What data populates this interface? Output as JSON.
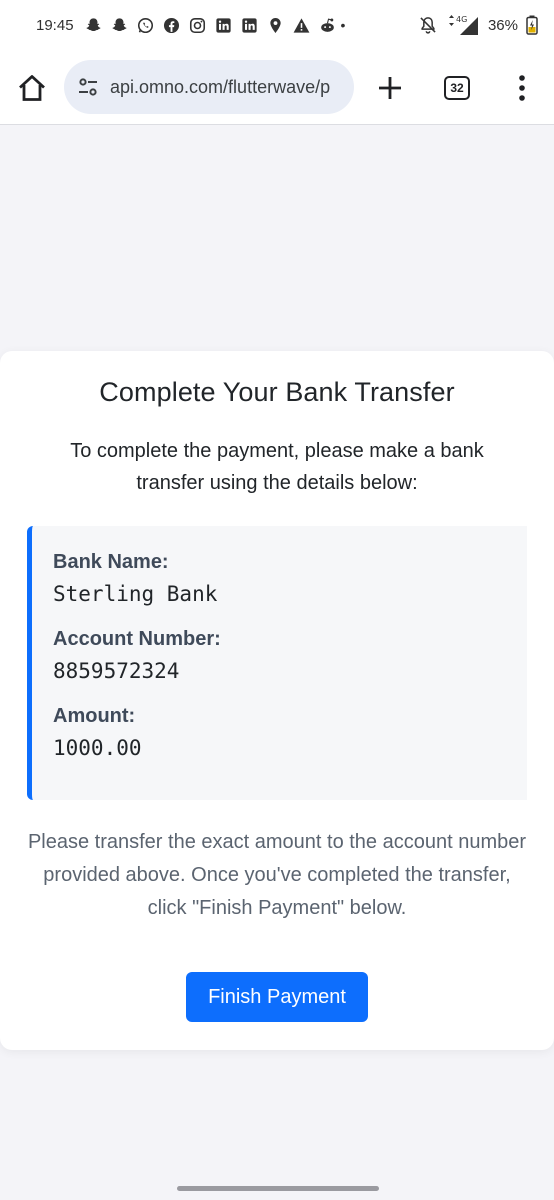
{
  "status_bar": {
    "time": "19:45",
    "notification_icons": [
      "snapchat-icon",
      "snapchat-icon",
      "whatsapp-icon",
      "facebook-icon",
      "instagram-icon",
      "linkedin-icon",
      "linkedin-icon",
      "location-pin-icon",
      "warning-icon",
      "reddit-icon"
    ],
    "network": "4G",
    "battery": "36%"
  },
  "browser": {
    "url": "api.omno.com/flutterwave/p",
    "tab_count": "32"
  },
  "card": {
    "title": "Complete Your Bank Transfer",
    "intro": "To complete the payment, please make a bank transfer using the details below:",
    "details": {
      "bank_name_label": "Bank Name:",
      "bank_name_value": "Sterling Bank",
      "account_number_label": "Account Number:",
      "account_number_value": "8859572324",
      "amount_label": "Amount:",
      "amount_value": "1000.00"
    },
    "note": "Please transfer the exact amount to the account number provided above. Once you've completed the transfer, click \"Finish Payment\" below.",
    "finish_button": "Finish Payment"
  },
  "colors": {
    "accent": "#0d6efd",
    "page_bg": "#f4f4f8",
    "card_bg": "#ffffff",
    "details_bg": "#f6f7f9"
  }
}
